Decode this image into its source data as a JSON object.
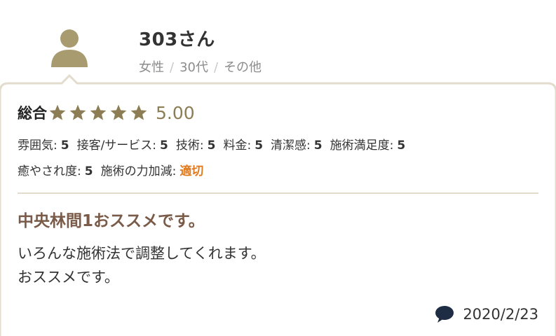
{
  "reviewer": {
    "name": "303さん",
    "gender": "女性",
    "age": "30代",
    "occupation": "その他",
    "separator": "/"
  },
  "rating": {
    "overall_label": "総合",
    "stars": 5,
    "score": "5.00",
    "line1": [
      {
        "label": "雰囲気:",
        "value": "5"
      },
      {
        "label": "接客/サービス:",
        "value": "5"
      },
      {
        "label": "技術:",
        "value": "5"
      },
      {
        "label": "料金:",
        "value": "5"
      },
      {
        "label": "清潔感:",
        "value": "5"
      },
      {
        "label": "施術満足度:",
        "value": "5"
      }
    ],
    "line2": [
      {
        "label": "癒やされ度:",
        "value": "5"
      },
      {
        "label": "施術の力加減:",
        "value": "適切"
      }
    ]
  },
  "review": {
    "title": "中央林間1おススメです。",
    "body_line1": "いろんな施術法で調整してくれます。",
    "body_line2": "おススメです。",
    "date": "2020/2/23"
  },
  "colors": {
    "avatar": "#a89b6f",
    "card_border": "#e2dccd",
    "star": "#8c7d55",
    "accent": "#e07a1f",
    "title": "#7a5a48",
    "comment_icon": "#1f2d44"
  },
  "icons": {
    "avatar": "user-silhouette-icon",
    "star": "star-icon",
    "comment": "speech-bubble-icon"
  }
}
